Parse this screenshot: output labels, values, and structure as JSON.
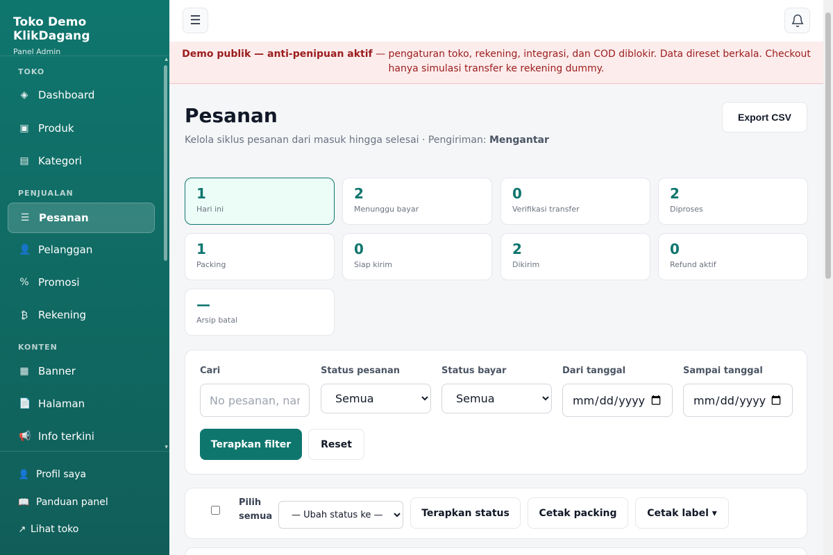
{
  "brand": {
    "title": "Toko Demo KlikDagang",
    "subtitle": "Panel Admin"
  },
  "sidebar": {
    "sections": [
      {
        "label": "TOKO",
        "items": [
          {
            "label": "Dashboard",
            "icon": "◈",
            "icon_name": "dashboard-icon"
          },
          {
            "label": "Produk",
            "icon": "▣",
            "icon_name": "product-icon"
          },
          {
            "label": "Kategori",
            "icon": "▤",
            "icon_name": "category-icon"
          }
        ]
      },
      {
        "label": "PENJUALAN",
        "items": [
          {
            "label": "Pesanan",
            "icon": "☰",
            "icon_name": "orders-icon",
            "active": true
          },
          {
            "label": "Pelanggan",
            "icon": "👤",
            "icon_name": "customer-icon"
          },
          {
            "label": "Promosi",
            "icon": "%",
            "icon_name": "promo-icon"
          },
          {
            "label": "Rekening",
            "icon": "₿",
            "icon_name": "bank-account-icon"
          }
        ]
      },
      {
        "label": "KONTEN",
        "items": [
          {
            "label": "Banner",
            "icon": "▦",
            "icon_name": "banner-icon"
          },
          {
            "label": "Halaman",
            "icon": "📄",
            "icon_name": "page-icon"
          },
          {
            "label": "Info terkini",
            "icon": "📢",
            "icon_name": "megaphone-icon"
          }
        ]
      }
    ],
    "footer": [
      {
        "label": "Profil saya",
        "icon": "👤",
        "icon_name": "profile-icon"
      },
      {
        "label": "Panduan panel",
        "icon": "📖",
        "icon_name": "guide-icon"
      },
      {
        "label": "Lihat toko",
        "icon": "↗",
        "icon_name": "external-link-icon"
      }
    ]
  },
  "topbar": {
    "menu_icon": "☰"
  },
  "alert": {
    "bold": "Demo publik — anti-penipuan aktif",
    "text": " — pengaturan toko, rekening, integrasi, dan COD diblokir. Data direset berkala. Checkout hanya simulasi transfer ke rekening dummy."
  },
  "page": {
    "title": "Pesanan",
    "subtitle_prefix": "Kelola siklus pesanan dari masuk hingga selesai · Pengiriman: ",
    "subtitle_bold": "Mengantar",
    "export_label": "Export CSV"
  },
  "stats": [
    {
      "value": "1",
      "label": "Hari ini",
      "active": true
    },
    {
      "value": "2",
      "label": "Menunggu bayar"
    },
    {
      "value": "0",
      "label": "Verifikasi transfer"
    },
    {
      "value": "2",
      "label": "Diproses"
    },
    {
      "value": "1",
      "label": "Packing"
    },
    {
      "value": "0",
      "label": "Siap kirim"
    },
    {
      "value": "2",
      "label": "Dikirim"
    },
    {
      "value": "0",
      "label": "Refund aktif"
    },
    {
      "value": "—",
      "label": "Arsip batal"
    }
  ],
  "filters": {
    "search_label": "Cari",
    "search_placeholder": "No pesanan, nama",
    "order_status_label": "Status pesanan",
    "order_status_value": "Semua",
    "pay_status_label": "Status bayar",
    "pay_status_value": "Semua",
    "from_label": "Dari tanggal",
    "to_label": "Sampai tanggal",
    "apply_label": "Terapkan filter",
    "reset_label": "Reset"
  },
  "bulk": {
    "select_all_label": "Pilih semua",
    "status_select_value": "— Ubah status ke —",
    "apply_status_label": "Terapkan status",
    "print_packing_label": "Cetak packing",
    "print_label_label": "Cetak label ▾"
  },
  "colors": {
    "brand": "#0f766e",
    "alert_bg": "#fdecec",
    "alert_text": "#9b1c1c"
  }
}
